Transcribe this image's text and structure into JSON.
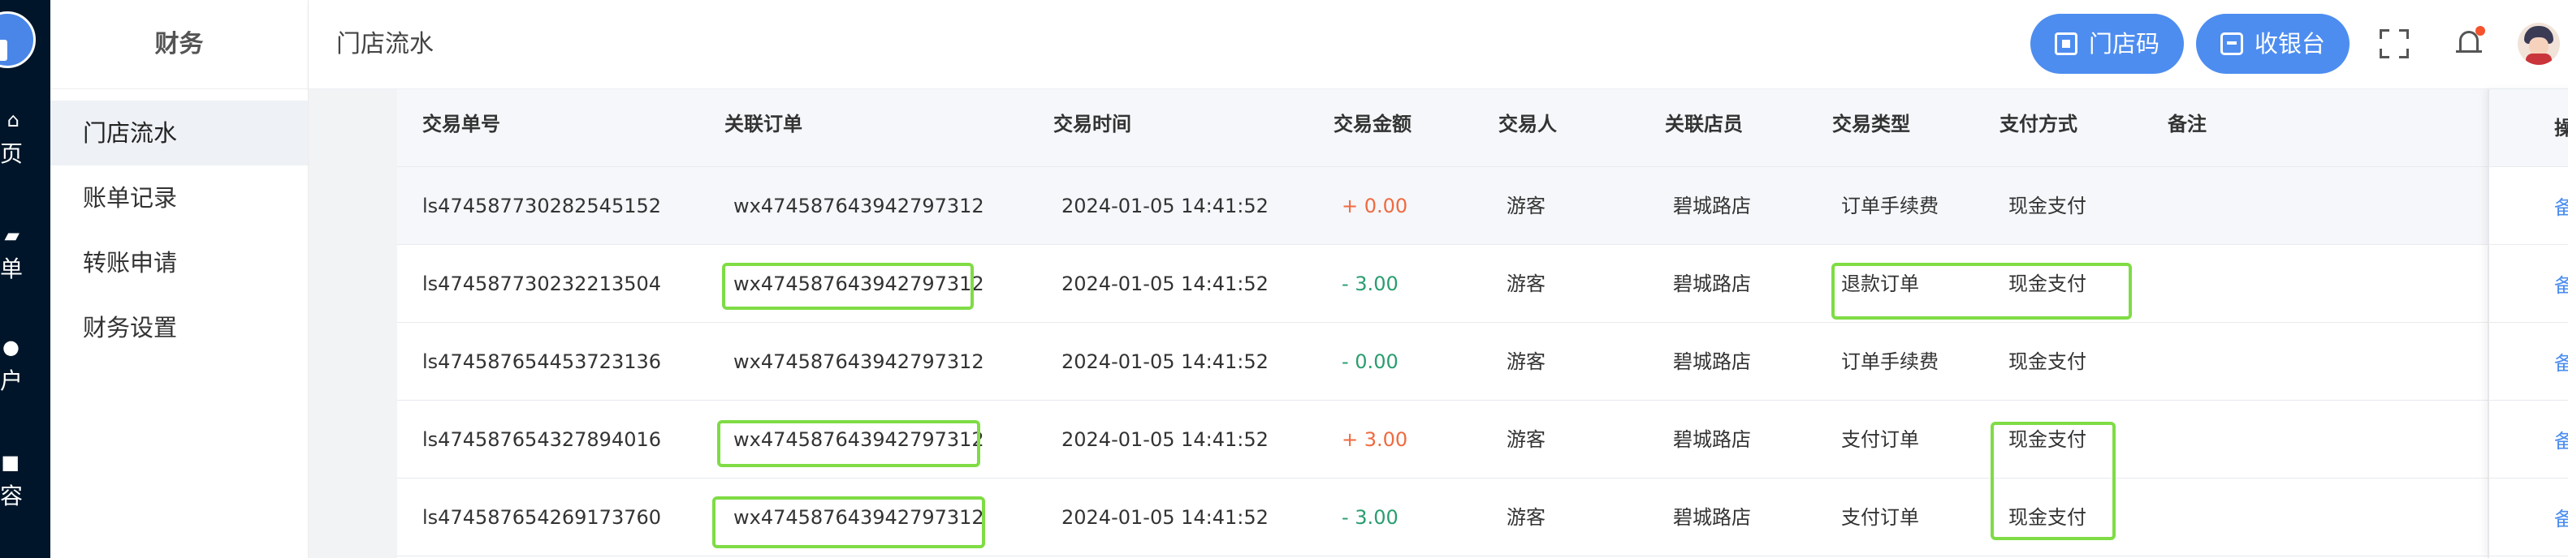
{
  "rail": {
    "items": [
      {
        "label": "页",
        "icon": "home-icon"
      },
      {
        "label": "单",
        "icon": "cart-icon"
      },
      {
        "label": "户",
        "icon": "users-icon"
      },
      {
        "label": "容",
        "icon": "content-icon"
      }
    ]
  },
  "sidebar": {
    "title": "财务",
    "items": [
      {
        "label": "门店流水",
        "active": true
      },
      {
        "label": "账单记录",
        "active": false
      },
      {
        "label": "转账申请",
        "active": false
      },
      {
        "label": "财务设置",
        "active": false
      }
    ]
  },
  "header": {
    "title": "门店流水",
    "store_code_label": "门店码",
    "cashier_label": "收银台",
    "accent_color": "#4d8df0"
  },
  "table": {
    "columns": [
      "交易单号",
      "关联订单",
      "交易时间",
      "交易金额",
      "交易人",
      "关联店员",
      "交易类型",
      "支付方式",
      "备注",
      "操作"
    ],
    "rows": [
      {
        "id": "ls474587730282545152",
        "order": "wx474587643942797312",
        "time": "2024-01-05 14:41:52",
        "amount": "+ 0.00",
        "sign": "pos",
        "person": "游客",
        "store": "碧城路店",
        "type": "订单手续费",
        "pay": "现金支付",
        "note": "",
        "action": "备注"
      },
      {
        "id": "ls474587730232213504",
        "order": "wx474587643942797312",
        "time": "2024-01-05 14:41:52",
        "amount": "- 3.00",
        "sign": "neg",
        "person": "游客",
        "store": "碧城路店",
        "type": "退款订单",
        "pay": "现金支付",
        "note": "",
        "action": "备注"
      },
      {
        "id": "ls474587654453723136",
        "order": "wx474587643942797312",
        "time": "2024-01-05 14:41:52",
        "amount": "- 0.00",
        "sign": "neg",
        "person": "游客",
        "store": "碧城路店",
        "type": "订单手续费",
        "pay": "现金支付",
        "note": "",
        "action": "备注"
      },
      {
        "id": "ls474587654327894016",
        "order": "wx474587643942797312",
        "time": "2024-01-05 14:41:52",
        "amount": "+ 3.00",
        "sign": "pos",
        "person": "游客",
        "store": "碧城路店",
        "type": "支付订单",
        "pay": "现金支付",
        "note": "",
        "action": "备注"
      },
      {
        "id": "ls474587654269173760",
        "order": "wx474587643942797312",
        "time": "2024-01-05 14:41:52",
        "amount": "- 3.00",
        "sign": "neg",
        "person": "游客",
        "store": "碧城路店",
        "type": "支付订单",
        "pay": "现金支付",
        "note": "",
        "action": "备注"
      }
    ]
  },
  "colors": {
    "positive_amount": "#f06a3f",
    "negative_amount": "#2a9d6f",
    "link": "#4a8cf0",
    "highlight": "#7fdc45"
  }
}
